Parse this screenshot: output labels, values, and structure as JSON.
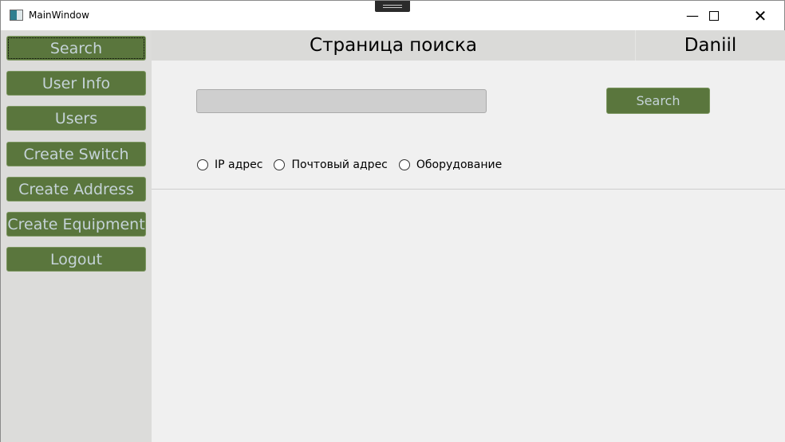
{
  "window": {
    "title": "MainWindow",
    "minimize_icon": "minimize-icon",
    "maximize_icon": "maximize-icon",
    "close_icon": "close-icon"
  },
  "sidebar": {
    "items": [
      {
        "label": "Search",
        "active": true
      },
      {
        "label": "User Info"
      },
      {
        "label": "Users"
      },
      {
        "label": "Create Switch"
      },
      {
        "label": "Create Address"
      },
      {
        "label": "Create Equipment"
      },
      {
        "label": "Logout"
      }
    ]
  },
  "header": {
    "title": "Страница поиска",
    "user": "Daniil"
  },
  "search": {
    "value": "",
    "button_label": "Search"
  },
  "radios": [
    {
      "label": "IP адрес",
      "checked": false
    },
    {
      "label": "Почтовый адрес",
      "checked": false
    },
    {
      "label": "Оборудование",
      "checked": false
    }
  ],
  "colors": {
    "button": "#5a763d",
    "button_text": "#c5d3d8",
    "sidebar": "#dcdcda",
    "content": "#f0f0f0"
  }
}
